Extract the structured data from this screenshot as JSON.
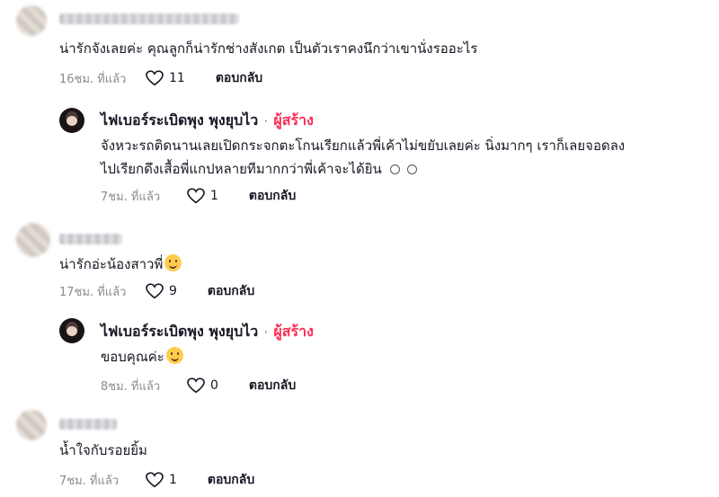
{
  "comments": [
    {
      "text": "น่ารักจังเลยค่ะ คุณลูกก็น่ารักช่างสังเกต เป็นตัวเราคงนึกว่าเขานั่งรออะไร",
      "time": "16ชม. ที่แล้ว",
      "likes": "11",
      "reply_label": "ตอบกลับ"
    },
    {
      "username": "ไฟเบอร์ระเบิดพุง พุงยุบไว",
      "separator": "·",
      "creator_badge": "ผู้สร้าง",
      "text_line1": "จังหวะรถติดนานเลยเปิดกระจกตะโกนเรียกแล้วพี่เค้าไม่ขยับเลยค่ะ นิ่งมากๆ เราก็เลยจอดลง",
      "text_line2": "ไปเรียกดึงเสื้อพี่แกปหลายทีมากกว่าพี่เค้าจะได้ยิน",
      "time": "7ชม. ที่แล้ว",
      "likes": "1",
      "reply_label": "ตอบกลับ"
    },
    {
      "text": "น่ารักอ่ะน้องสาวพี่",
      "time": "17ชม. ที่แล้ว",
      "likes": "9",
      "reply_label": "ตอบกลับ"
    },
    {
      "username": "ไฟเบอร์ระเบิดพุง พุงยุบไว",
      "separator": "·",
      "creator_badge": "ผู้สร้าง",
      "text": "ขอบคุณค่ะ",
      "time": "8ชม. ที่แล้ว",
      "likes": "0",
      "reply_label": "ตอบกลับ"
    },
    {
      "text": "น้ำใจกับรอยยิ้ม",
      "time": "7ชม. ที่แล้ว",
      "likes": "1",
      "reply_label": "ตอบกลับ"
    }
  ],
  "colors": {
    "creator": "#fe2c55",
    "meta": "#8a8b91",
    "text": "#161823"
  }
}
